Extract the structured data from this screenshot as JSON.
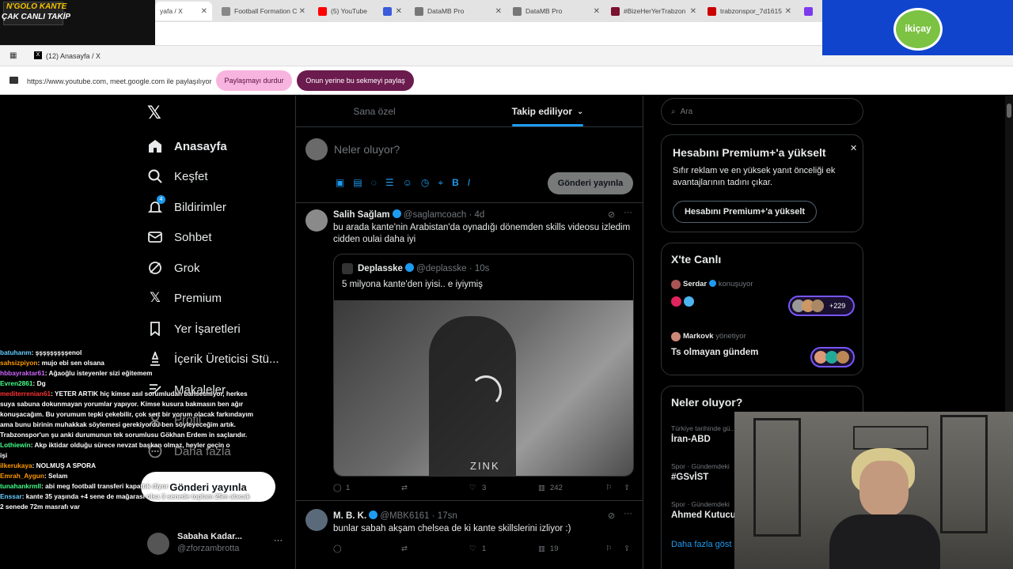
{
  "stream_logo": {
    "line1": "N'GOLO KANTE",
    "line2": "ÇAK CANLI TAKİP"
  },
  "sponsor": {
    "name": "ikiçay"
  },
  "tabs": [
    {
      "label": "yafa / X",
      "icon": "x-icon",
      "color": "#000"
    },
    {
      "label": "Football Formation C",
      "icon": "page-icon",
      "color": "#888"
    },
    {
      "label": "(5) YouTube",
      "icon": "youtube-icon",
      "color": "#ff0000"
    },
    {
      "label": "",
      "icon": "app-icon",
      "color": "#3b5bdb"
    },
    {
      "label": "DataMB Pro",
      "icon": "datamb-icon",
      "color": "#777"
    },
    {
      "label": "DataMB Pro",
      "icon": "datamb-icon",
      "color": "#777"
    },
    {
      "label": "#BizeHerYerTrabzon",
      "icon": "trabzon-icon",
      "color": "#7a1230"
    },
    {
      "label": "trabzonspor_7d1615",
      "icon": "pdf-icon",
      "color": "#c00"
    },
    {
      "label": "S",
      "icon": "s-icon",
      "color": "#7c3aed"
    }
  ],
  "window": {
    "title": "(12) Anasayfa / X"
  },
  "share": {
    "message": "https://www.youtube.com, meet.google.com ile paylaşılıyor",
    "stop_label": "Paylaşmayı durdur",
    "switch_label": "Onun yerine bu sekmeyi paylaş"
  },
  "nav": [
    {
      "label": "Anasayfa",
      "icon": "home-icon"
    },
    {
      "label": "Keşfet",
      "icon": "search-icon"
    },
    {
      "label": "Bildirimler",
      "icon": "bell-icon",
      "badge": "4"
    },
    {
      "label": "Sohbet",
      "icon": "mail-icon"
    },
    {
      "label": "Grok",
      "icon": "grok-icon"
    },
    {
      "label": "Premium",
      "icon": "x-premium-icon"
    },
    {
      "label": "Yer İşaretleri",
      "icon": "bookmark-icon"
    },
    {
      "label": "İçerik Üreticisi Stü...",
      "icon": "creator-icon"
    },
    {
      "label": "Makaleler",
      "icon": "article-icon"
    },
    {
      "label": "Profil",
      "icon": "profile-icon"
    },
    {
      "label": "Daha fazla",
      "icon": "more-icon"
    }
  ],
  "post_button": "Gönderi yayınla",
  "account": {
    "name": "Sabaha Kadar...",
    "handle": "@zforzambrotta"
  },
  "feed": {
    "tab_foryou": "Sana özel",
    "tab_following": "Takip ediliyor",
    "composer_placeholder": "Neler oluyor?",
    "composer_post": "Gönderi yayınla",
    "tweets": [
      {
        "name": "Salih Sağlam",
        "handle": "@saglamcoach",
        "time": "4d",
        "text": "bu arada kante'nin Arabistan'da oynadığı dönemden skills videosu izledim cidden oulai daha iyi",
        "quote": {
          "name": "Deplasske",
          "handle": "@deplasske",
          "time": "10s",
          "text": "5 milyona kante'den iyisi.. e iyiymiş",
          "watermark": "ZINK"
        },
        "replies": "1",
        "retweets": "",
        "likes": "3",
        "views": "242"
      },
      {
        "name": "M. B. K.",
        "handle": "@MBK6161",
        "time": "17sn",
        "text": "bunlar sabah akşam chelsea de ki kante skillslerini izliyor :)",
        "replies": "",
        "retweets": "",
        "likes": "1",
        "views": "19"
      }
    ]
  },
  "right": {
    "search_placeholder": "Ara",
    "premium": {
      "title": "Hesabını Premium+'a yükselt",
      "body": "Sıfır reklam ve en yüksek yanıt önceliği ek avantajlarının tadını çıkar.",
      "button": "Hesabını Premium+'a yükselt"
    },
    "live": {
      "title": "X'te Canlı",
      "space1": {
        "host": "Serdar",
        "role": "konuşuyor",
        "count": "+229"
      },
      "space2": {
        "host": "Markovk",
        "role": "yönetiyor",
        "title": "Ts olmayan gündem"
      }
    },
    "trends": {
      "title": "Neler oluyor?",
      "items": [
        {
          "meta": "Türkiye tarihinde gü...",
          "name": "İran-ABD"
        },
        {
          "meta": "Spor · Gündemdeki",
          "name": "#GSvİST"
        },
        {
          "meta": "Spor · Gündemdeki",
          "name": "Ahmed Kutucu"
        }
      ],
      "more": "Daha fazla göst"
    }
  },
  "chat": [
    {
      "user": "batuhanm",
      "color": "#6cf",
      "msg": ": şşşşşşşşşenol"
    },
    {
      "user": "sahsizpiyon",
      "color": "#f90",
      "msg": ": mujo ebi sen olsana"
    },
    {
      "user": "hbbayraktar61",
      "color": "#c6f",
      "msg": ": Ağaoğlu isteyenler sizi eğitemem"
    },
    {
      "user": "Evren2861",
      "color": "#4f8",
      "msg": ": Dg"
    },
    {
      "user": "mediterrenian61",
      "color": "#f33",
      "msg": ": YETER ARTIK hiç kimse asıl sorumludan bahsetmiyor, herkes"
    },
    {
      "user": "",
      "color": "#fff",
      "msg": "suya sabuna dokunmayan yorumlar yapıyor. Kimse kusura bakmasın ben ağır"
    },
    {
      "user": "",
      "color": "#fff",
      "msg": "konuşacağım. Bu yorumum tepki çekebilir, çok sert bir yorum olacak farkındayım"
    },
    {
      "user": "",
      "color": "#fff",
      "msg": "ama bunu birinin muhakkak söylemesi gerekiyordu ben söyleyeceğim artık."
    },
    {
      "user": "",
      "color": "#fff",
      "msg": "Trabzonspor'un şu anki durumunun tek sorumlusu Gökhan Erdem in saçlarıdır."
    },
    {
      "user": "Lothiewin",
      "color": "#4f8",
      "msg": ": Akp iktidar olduğu sürece nevzat başkan olmaz, heyler geçin o"
    },
    {
      "user": "",
      "color": "#fff",
      "msg": "işi"
    },
    {
      "user": "ilkerukaya",
      "color": "#f90",
      "msg": ": NOLMUŞ A SPORA"
    },
    {
      "user": "Emrah_Aygun",
      "color": "#f90",
      "msg": ": Selam"
    },
    {
      "user": "tunahankrmll",
      "color": "#4f8",
      "msg": ": abi meg football transferi kapattık diyor"
    },
    {
      "user": "Enssar",
      "color": "#6cf",
      "msg": ": kante 35 yaşında +4 sene de mağarası olsa 3 senede toplam 25m alacak"
    },
    {
      "user": "",
      "color": "#fff",
      "msg": "2 senede 72m masrafı var"
    }
  ]
}
